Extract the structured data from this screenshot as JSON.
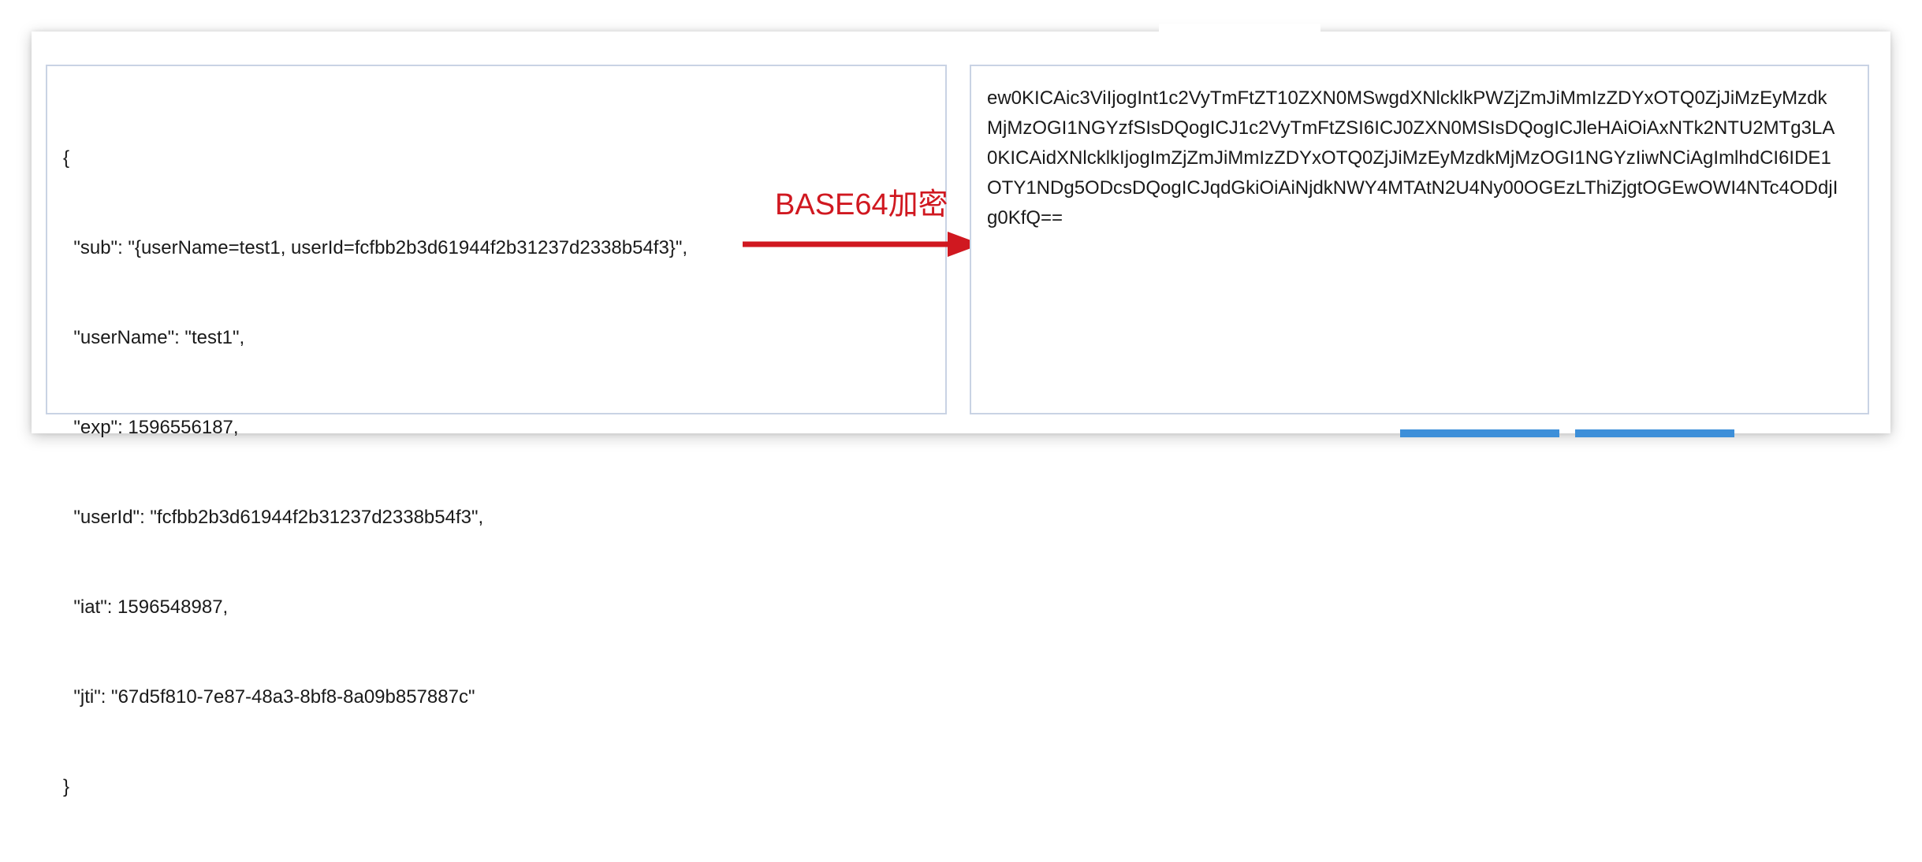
{
  "json_lines": [
    "{",
    "  \"sub\": \"{userName=test1, userId=fcfbb2b3d61944f2b31237d2338b54f3}\",",
    "  \"userName\": \"test1\",",
    "  \"exp\": 1596556187,",
    "  \"userId\": \"fcfbb2b3d61944f2b31237d2338b54f3\",",
    "  \"iat\": 1596548987,",
    "  \"jti\": \"67d5f810-7e87-48a3-8bf8-8a09b857887c\"",
    "}"
  ],
  "arrow_label": "BASE64加密",
  "encoded_text": "ew0KICAic3ViIjogInt1c2VyTmFtZT10ZXN0MSwgdXNlcklkPWZjZmJiMmIzZDYxOTQ0ZjJiMzEyMzdkMjMzOGI1NGYzfSIsDQogICJ1c2VyTmFtZSI6ICJ0ZXN0MSIsDQogICJleHAiOiAxNTk2NTU2MTg3LA0KICAidXNlcklkIjogImZjZmJiMmIzZDYxOTQ0ZjJiMzEyMzdkMjMzOGI1NGYzIiwNCiAgImlhdCI6IDE1OTY1NDg5ODcsDQogICJqdGkiOiAiNjdkNWY4MTAtN2U4Ny00OGEzLThiZjgtOGEwOWI4NTc4ODdjIg0KfQ==",
  "colors": {
    "arrow": "#d01820",
    "button": "#3d8fd9",
    "border": "#c9d3e4"
  }
}
